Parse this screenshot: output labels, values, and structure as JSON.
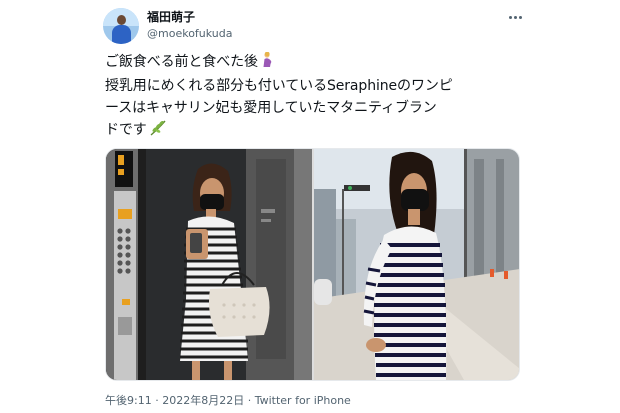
{
  "user": {
    "display_name": "福田萌子",
    "handle": "@moekofukuda",
    "avatar_icon": "profile-avatar"
  },
  "tweet": {
    "lines": [
      "ご飯食べる前と食べた後",
      "授乳用にめくれる部分も付いているSeraphineのワンピ",
      "ースはキャサリン妃も愛用していたマタニティブラン",
      "ドです"
    ],
    "emojis": [
      "pregnant-woman-emoji",
      "herb-emoji"
    ]
  },
  "media": {
    "photos": [
      {
        "icon": "elevator-selfie-photo"
      },
      {
        "icon": "street-photo"
      }
    ]
  },
  "meta": {
    "time": "午後9:11",
    "separator": "·",
    "date": "2022年8月22日",
    "source": "Twitter for iPhone"
  },
  "colors": {
    "text": "#0f1419",
    "secondary": "#536471"
  },
  "icons": {
    "more": "more-options-icon"
  }
}
